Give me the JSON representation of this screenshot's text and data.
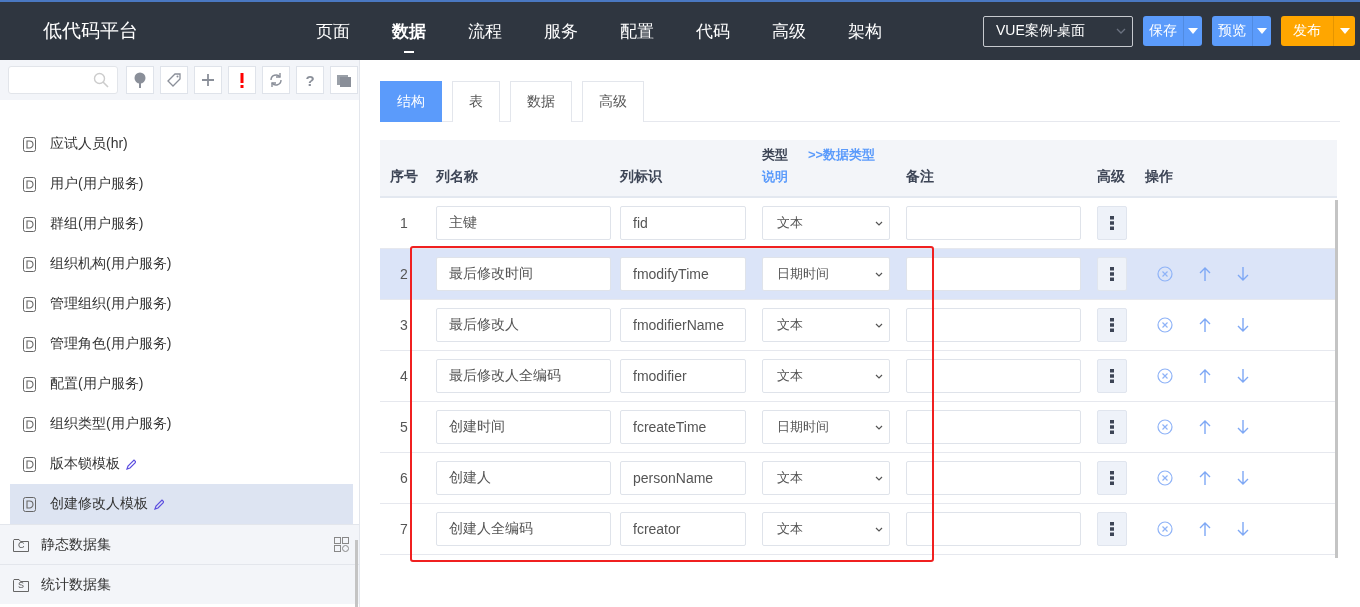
{
  "app": {
    "title": "低代码平台"
  },
  "nav": [
    {
      "label": "页面",
      "selected": false
    },
    {
      "label": "数据",
      "selected": true
    },
    {
      "label": "流程",
      "selected": false
    },
    {
      "label": "服务",
      "selected": false
    },
    {
      "label": "配置",
      "selected": false
    },
    {
      "label": "代码",
      "selected": false
    },
    {
      "label": "高级",
      "selected": false
    },
    {
      "label": "架构",
      "selected": false
    }
  ],
  "project_select": {
    "value": "VUE案例-桌面"
  },
  "actions": [
    {
      "label": "保存",
      "kind": "blue"
    },
    {
      "label": "预览",
      "kind": "blue"
    },
    {
      "label": "发布",
      "kind": "orange"
    }
  ],
  "sidebar": {
    "toolbar": [
      {
        "kind": "tree"
      },
      {
        "kind": "tag"
      },
      {
        "kind": "add"
      },
      {
        "kind": "alert"
      },
      {
        "kind": "refresh"
      },
      {
        "kind": "help",
        "label": "?"
      },
      {
        "kind": "layers"
      }
    ],
    "items": [
      {
        "label": "应试人员(hr)",
        "selected": false,
        "editable": false
      },
      {
        "label": "用户(用户服务)",
        "selected": false,
        "editable": false
      },
      {
        "label": "群组(用户服务)",
        "selected": false,
        "editable": false
      },
      {
        "label": "组织机构(用户服务)",
        "selected": false,
        "editable": false
      },
      {
        "label": "管理组织(用户服务)",
        "selected": false,
        "editable": false
      },
      {
        "label": "管理角色(用户服务)",
        "selected": false,
        "editable": false
      },
      {
        "label": "配置(用户服务)",
        "selected": false,
        "editable": false
      },
      {
        "label": "组织类型(用户服务)",
        "selected": false,
        "editable": false
      },
      {
        "label": "版本锁模板",
        "selected": false,
        "editable": true
      },
      {
        "label": "创建修改人模板",
        "selected": true,
        "editable": true
      }
    ],
    "groups": [
      {
        "label": "静态数据集",
        "letter": "C",
        "grid": true
      },
      {
        "label": "统计数据集",
        "letter": "S",
        "grid": false
      }
    ]
  },
  "tabs": [
    {
      "label": "结构",
      "selected": true
    },
    {
      "label": "表",
      "selected": false
    },
    {
      "label": "数据",
      "selected": false
    },
    {
      "label": "高级",
      "selected": false
    }
  ],
  "table": {
    "columns": {
      "index": "序号",
      "name": "列名称",
      "id": "列标识",
      "type": "类型",
      "type_help": "说明",
      "type_link": ">>数据类型",
      "note": "备注",
      "advanced": "高级",
      "ops": "操作"
    },
    "rows": [
      {
        "index": "1",
        "name": "主键",
        "id": "fid",
        "type": "文本",
        "selected": false,
        "actions": false
      },
      {
        "index": "2",
        "name": "最后修改时间",
        "id": "fmodifyTime",
        "type": "日期时间",
        "selected": true,
        "actions": true
      },
      {
        "index": "3",
        "name": "最后修改人",
        "id": "fmodifierName",
        "type": "文本",
        "selected": false,
        "actions": true
      },
      {
        "index": "4",
        "name": "最后修改人全编码",
        "id": "fmodifier",
        "type": "文本",
        "selected": false,
        "actions": true
      },
      {
        "index": "5",
        "name": "创建时间",
        "id": "fcreateTime",
        "type": "日期时间",
        "selected": false,
        "actions": true
      },
      {
        "index": "6",
        "name": "创建人",
        "id": "personName",
        "type": "文本",
        "selected": false,
        "actions": true
      },
      {
        "index": "7",
        "name": "创建人全编码",
        "id": "fcreator",
        "type": "文本",
        "selected": false,
        "actions": true
      }
    ]
  }
}
